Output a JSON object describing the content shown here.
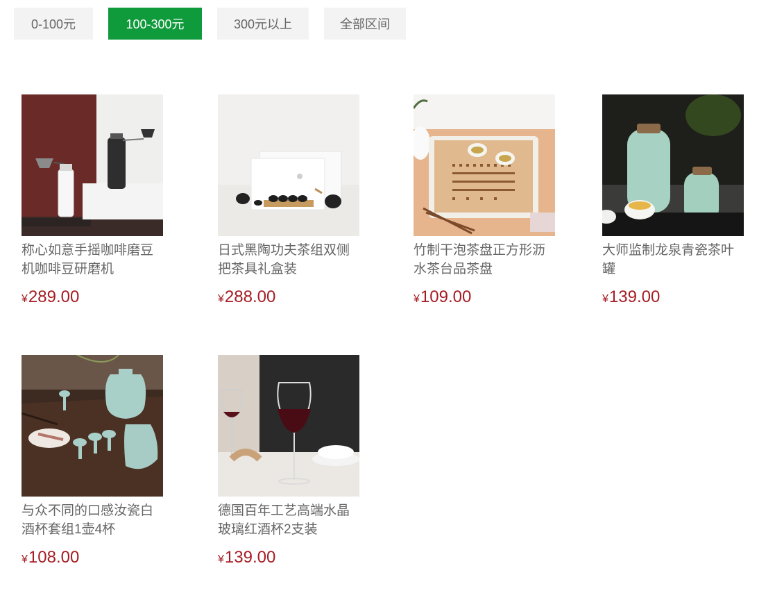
{
  "filters": [
    {
      "label": "0-100元",
      "active": false
    },
    {
      "label": "100-300元",
      "active": true
    },
    {
      "label": "300元以上",
      "active": false
    },
    {
      "label": "全部区间",
      "active": false
    }
  ],
  "currency_symbol": "¥",
  "products": [
    {
      "title": "称心如意手摇咖啡磨豆机咖啡豆研磨机",
      "price": "289.00",
      "image": "coffee-grinder-image"
    },
    {
      "title": "日式黑陶功夫茶组双侧把茶具礼盒装",
      "price": "288.00",
      "image": "black-tea-set-image"
    },
    {
      "title": "竹制干泡茶盘正方形沥水茶台品茶盘",
      "price": "109.00",
      "image": "bamboo-tea-tray-image"
    },
    {
      "title": "大师监制龙泉青瓷茶叶罐",
      "price": "139.00",
      "image": "celadon-tea-jar-image"
    },
    {
      "title": "与众不同的口感汝瓷白酒杯套组1壶4杯",
      "price": "108.00",
      "image": "ru-porcelain-wine-set-image"
    },
    {
      "title": "德国百年工艺高端水晶玻璃红酒杯2支装",
      "price": "139.00",
      "image": "crystal-wine-glass-image"
    }
  ],
  "colors": {
    "accent": "#0f9a3b",
    "price": "#a51d24"
  }
}
